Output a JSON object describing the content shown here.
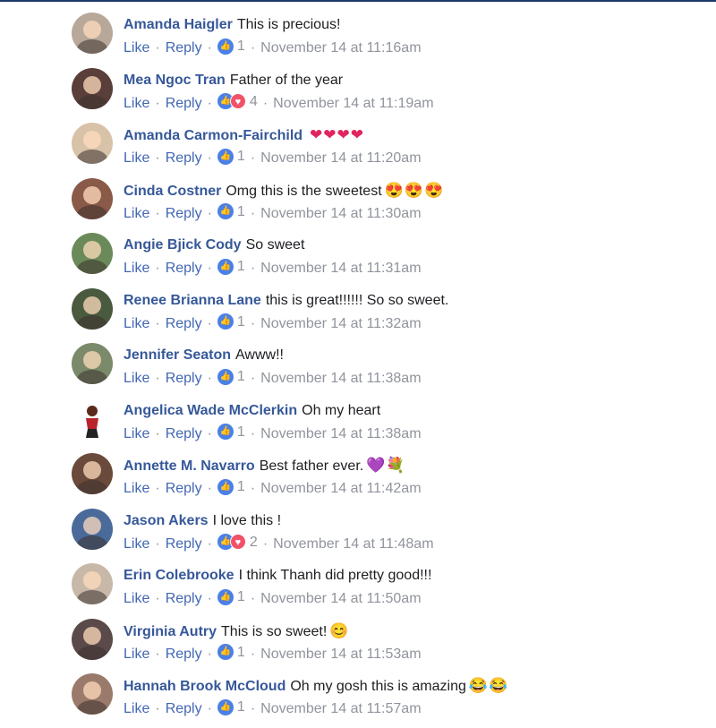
{
  "actions": {
    "like": "Like",
    "reply": "Reply",
    "separator": "·"
  },
  "icons": {
    "like": "thumbs-up-like-icon",
    "love": "heart-love-icon"
  },
  "colors": {
    "author": "#365899",
    "link": "#4267b2",
    "meta": "#90949c",
    "like": "#4a80e8",
    "love": "#f25268"
  },
  "comments": [
    {
      "author": "Amanda Haigler",
      "text": "This is precious!",
      "emoji": "",
      "reactions": [
        "like"
      ],
      "count": "1",
      "time": "November 14 at 11:16am",
      "avatar_color": "#b8a89a"
    },
    {
      "author": "Mea Ngoc Tran",
      "text": "Father of the year",
      "emoji": "",
      "reactions": [
        "like",
        "love"
      ],
      "count": "4",
      "time": "November 14 at 11:19am",
      "avatar_color": "#5a3e3a"
    },
    {
      "author": "Amanda Carmon-Fairchild",
      "text": "",
      "emoji": "❤❤❤❤",
      "reactions": [
        "like"
      ],
      "count": "1",
      "time": "November 14 at 11:20am",
      "avatar_color": "#d8c2a8"
    },
    {
      "author": "Cinda Costner",
      "text": "Omg this is the sweetest",
      "emoji": "😍😍😍",
      "reactions": [
        "like"
      ],
      "count": "1",
      "time": "November 14 at 11:30am",
      "avatar_color": "#8a5a48"
    },
    {
      "author": "Angie Bjick Cody",
      "text": "So sweet",
      "emoji": "",
      "reactions": [
        "like"
      ],
      "count": "1",
      "time": "November 14 at 11:31am",
      "avatar_color": "#6b8a5a"
    },
    {
      "author": "Renee Brianna Lane",
      "text": "this is great!!!!!! So so sweet.",
      "emoji": "",
      "reactions": [
        "like"
      ],
      "count": "1",
      "time": "November 14 at 11:32am",
      "avatar_color": "#4a5a3e"
    },
    {
      "author": "Jennifer Seaton",
      "text": "Awww!!",
      "emoji": "",
      "reactions": [
        "like"
      ],
      "count": "1",
      "time": "November 14 at 11:38am",
      "avatar_color": "#7a8a6a"
    },
    {
      "author": "Angelica Wade McClerkin",
      "text": "Oh my heart",
      "emoji": "",
      "reactions": [
        "like"
      ],
      "count": "1",
      "time": "November 14 at 11:38am",
      "avatar_color": "#ffffff"
    },
    {
      "author": "Annette M. Navarro",
      "text": "Best father ever.",
      "emoji": "💜💐",
      "reactions": [
        "like"
      ],
      "count": "1",
      "time": "November 14 at 11:42am",
      "avatar_color": "#6a4a3a"
    },
    {
      "author": "Jason Akers",
      "text": "I love this !",
      "emoji": "",
      "reactions": [
        "like",
        "love"
      ],
      "count": "2",
      "time": "November 14 at 11:48am",
      "avatar_color": "#4a6a9a"
    },
    {
      "author": "Erin Colebrooke",
      "text": "I think Thanh did pretty good!!!",
      "emoji": "",
      "reactions": [
        "like"
      ],
      "count": "1",
      "time": "November 14 at 11:50am",
      "avatar_color": "#c8b8a8"
    },
    {
      "author": "Virginia Autry",
      "text": "This is so sweet!",
      "emoji": "😊",
      "reactions": [
        "like"
      ],
      "count": "1",
      "time": "November 14 at 11:53am",
      "avatar_color": "#5a4a4a"
    },
    {
      "author": "Hannah Brook McCloud",
      "text": "Oh my gosh this is amazing",
      "emoji": "😂😂",
      "reactions": [
        "like"
      ],
      "count": "1",
      "time": "November 14 at 11:57am",
      "avatar_color": "#9a7a6a"
    }
  ]
}
